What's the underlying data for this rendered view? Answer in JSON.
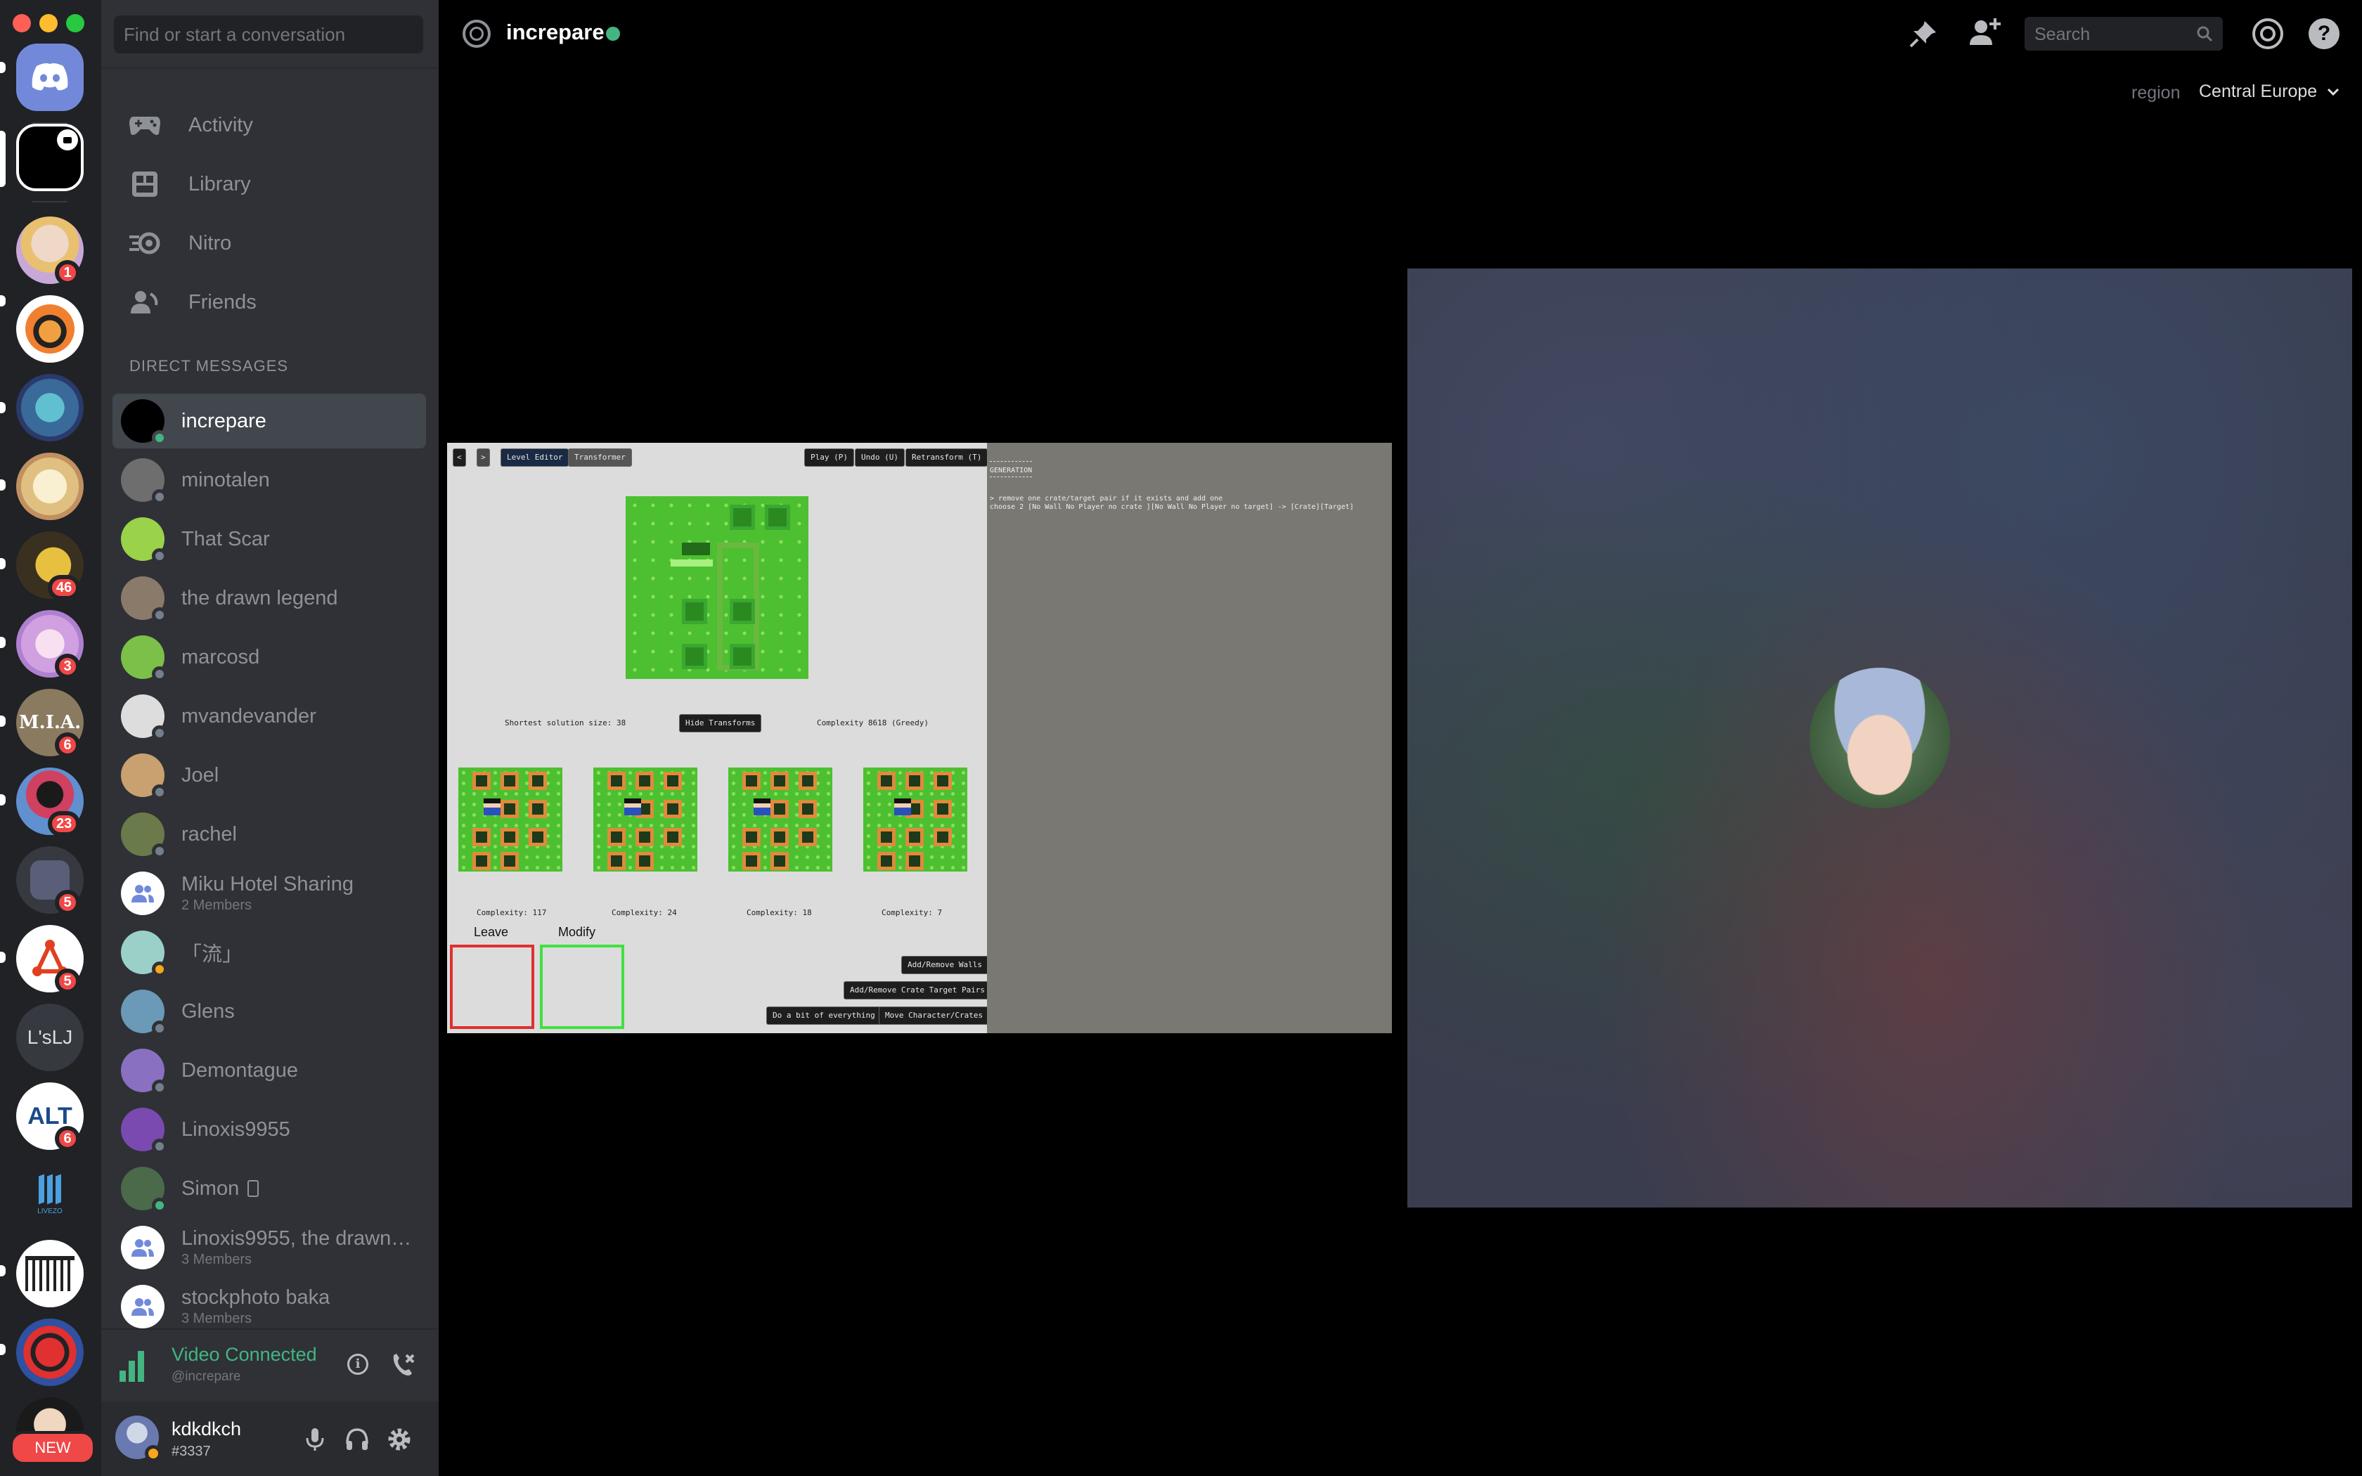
{
  "rail": {
    "home_icon": "discord-logo-icon",
    "servers": [
      {
        "badge": ""
      },
      {
        "badge": "1"
      },
      {
        "badge": ""
      },
      {
        "badge": ""
      },
      {
        "badge": ""
      },
      {
        "badge": "46"
      },
      {
        "badge": "3"
      },
      {
        "badge": "6",
        "text": "M.I.A."
      },
      {
        "badge": "23"
      },
      {
        "badge": "5"
      },
      {
        "badge": "5"
      },
      {
        "badge": "",
        "text": "L'sLJ"
      },
      {
        "badge": "6",
        "text": "ALT"
      },
      {
        "badge": "",
        "text": "LIVEZO"
      },
      {
        "badge": ""
      },
      {
        "badge": ""
      },
      {
        "badge": "NEW"
      }
    ]
  },
  "sidebar": {
    "search_placeholder": "Find or start a conversation",
    "nav": [
      {
        "label": "Activity",
        "icon": "gamepad-icon"
      },
      {
        "label": "Library",
        "icon": "library-icon"
      },
      {
        "label": "Nitro",
        "icon": "nitro-icon"
      },
      {
        "label": "Friends",
        "icon": "friends-wave-icon"
      }
    ],
    "dm_header": "DIRECT MESSAGES",
    "dms": [
      {
        "name": "increpare",
        "sub": "",
        "status": "#43b581",
        "color": "#000000",
        "selected": true
      },
      {
        "name": "minotalen",
        "sub": "",
        "status": "#747f8d",
        "color": "#6e6e6e"
      },
      {
        "name": "That Scar",
        "sub": "",
        "status": "#747f8d",
        "color": "#9ad24a"
      },
      {
        "name": "the drawn legend",
        "sub": "",
        "status": "#747f8d",
        "color": "#8a7a6a"
      },
      {
        "name": "marcosd",
        "sub": "",
        "status": "#747f8d",
        "color": "#7cc04a"
      },
      {
        "name": "mvandevander",
        "sub": "",
        "status": "#747f8d",
        "color": "#dddddd"
      },
      {
        "name": "Joel",
        "sub": "",
        "status": "#747f8d",
        "color": "#c9a070"
      },
      {
        "name": "rachel",
        "sub": "",
        "status": "#747f8d",
        "color": "#6a7a4a"
      },
      {
        "name": "Miku Hotel Sharing",
        "sub": "2 Members",
        "status": "",
        "color": "#ffffff",
        "group": true
      },
      {
        "name": "「流」",
        "sub": "",
        "status": "#faa61a",
        "color": "#9ad0c8"
      },
      {
        "name": "Glens",
        "sub": "",
        "status": "#747f8d",
        "color": "#6a9ab8"
      },
      {
        "name": "Demontague",
        "sub": "",
        "status": "#747f8d",
        "color": "#8a70c0"
      },
      {
        "name": "Linoxis9955",
        "sub": "",
        "status": "#747f8d",
        "color": "#7a4ab0"
      },
      {
        "name": "Simon",
        "sub": "",
        "status": "#43b581",
        "color": "#4a6a4a",
        "mobile": true
      },
      {
        "name": "Linoxis9955, the drawn ...",
        "sub": "3 Members",
        "status": "",
        "color": "#ffffff",
        "group": true
      },
      {
        "name": "stockphoto baka",
        "sub": "3 Members",
        "status": "",
        "color": "#ffffff",
        "group": true
      }
    ],
    "voice": {
      "status": "Video Connected",
      "channel": "@increpare"
    },
    "user": {
      "name": "kdkdkch",
      "tag": "#3337"
    }
  },
  "header": {
    "channel": "increpare",
    "search_placeholder": "Search",
    "region_label": "region",
    "region_value": "Central Europe"
  },
  "game": {
    "toolbar_left": [
      "<",
      ">",
      "Level Editor",
      "Transformer"
    ],
    "toolbar_right": [
      "Play (P)",
      "Undo (U)",
      "Retransform (T)"
    ],
    "shortest": "Shortest solution size: 38",
    "hide_btn": "Hide Transforms",
    "complexity_main": "Complexity 8618 (Greedy)",
    "complexities": [
      "Complexity: 117",
      "Complexity: 24",
      "Complexity: 18",
      "Complexity: 7"
    ],
    "leave": "Leave",
    "modify": "Modify",
    "actions": [
      "Add/Remove Walls",
      "Add/Remove Crate Target Pairs",
      "Do a bit of everything",
      "Move Character/Crates"
    ],
    "log_title": "GENERATION",
    "log_line1": "> remove one crate/target pair if it exists and add one",
    "log_line2": "choose 2 [No Wall No Player no crate ][No Wall No Player no target] -> [Crate][Target]"
  },
  "colors": {
    "accent": "#7289da",
    "online": "#43b581",
    "idle": "#faa61a",
    "offline": "#747f8d",
    "badge": "#f04747",
    "voice": "#43b581"
  }
}
